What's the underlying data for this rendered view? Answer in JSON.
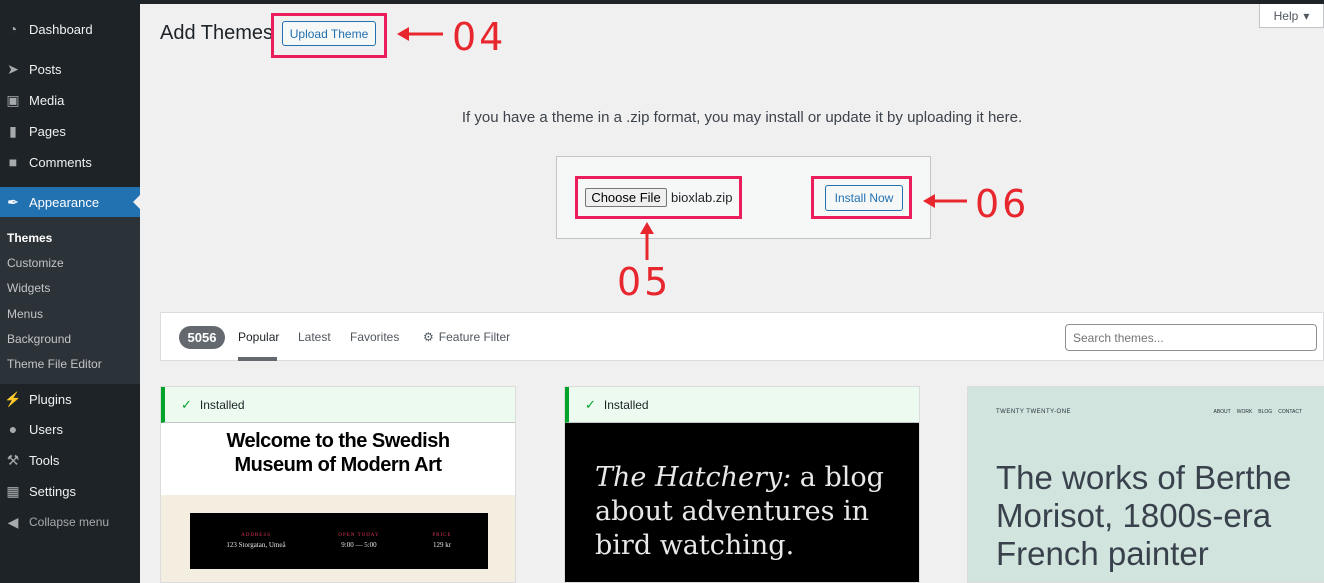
{
  "sidebar": {
    "items": [
      {
        "label": "Dashboard",
        "icon": "dashboard-icon"
      },
      {
        "label": "Posts",
        "icon": "pin-icon"
      },
      {
        "label": "Media",
        "icon": "media-icon"
      },
      {
        "label": "Pages",
        "icon": "pages-icon"
      },
      {
        "label": "Comments",
        "icon": "comment-icon"
      },
      {
        "label": "Appearance",
        "icon": "brush-icon"
      },
      {
        "label": "Plugins",
        "icon": "plug-icon"
      },
      {
        "label": "Users",
        "icon": "user-icon"
      },
      {
        "label": "Tools",
        "icon": "wrench-icon"
      },
      {
        "label": "Settings",
        "icon": "settings-icon"
      }
    ],
    "submenu": [
      "Themes",
      "Customize",
      "Widgets",
      "Menus",
      "Background",
      "Theme File Editor"
    ],
    "collapse_label": "Collapse menu"
  },
  "header": {
    "title": "Add Themes",
    "upload_label": "Upload Theme",
    "help_label": "Help"
  },
  "annotations": {
    "a04": "04",
    "a05": "05",
    "a06": "06",
    "color": "#e8262e"
  },
  "upload": {
    "description": "If you have a theme in a .zip format, you may install or update it by uploading it here.",
    "choose_label": "Choose File",
    "filename": "bioxlab.zip",
    "install_label": "Install Now"
  },
  "filter": {
    "count": "5056",
    "tabs": [
      "Popular",
      "Latest",
      "Favorites"
    ],
    "feature_filter": "Feature Filter",
    "search_placeholder": "Search themes..."
  },
  "themes": {
    "installed_label": "Installed",
    "card1": {
      "headline1": "Welcome to the Swedish",
      "headline2": "Museum of Modern Art",
      "cols": [
        {
          "t": "ADDRESS",
          "v": "123 Storgatan, Umeå"
        },
        {
          "t": "OPEN TODAY",
          "v": "9:00 — 5:00"
        },
        {
          "t": "PRICE",
          "v": "129 kr"
        }
      ]
    },
    "card2": {
      "italic": "The Hatchery:",
      "line1": " a blog",
      "line2": "about adventures in",
      "line3": "bird watching."
    },
    "card3": {
      "site": "TWENTY TWENTY-ONE",
      "nav": [
        "ABOUT",
        "WORK",
        "BLOG",
        "CONTACT"
      ],
      "line1": "The works of Berthe",
      "line2": "Morisot, 1800s-era",
      "line3": "French painter"
    }
  },
  "colors": {
    "accent": "#2271b1",
    "sidebar": "#1d2327",
    "highlight": "#e91e5a"
  }
}
